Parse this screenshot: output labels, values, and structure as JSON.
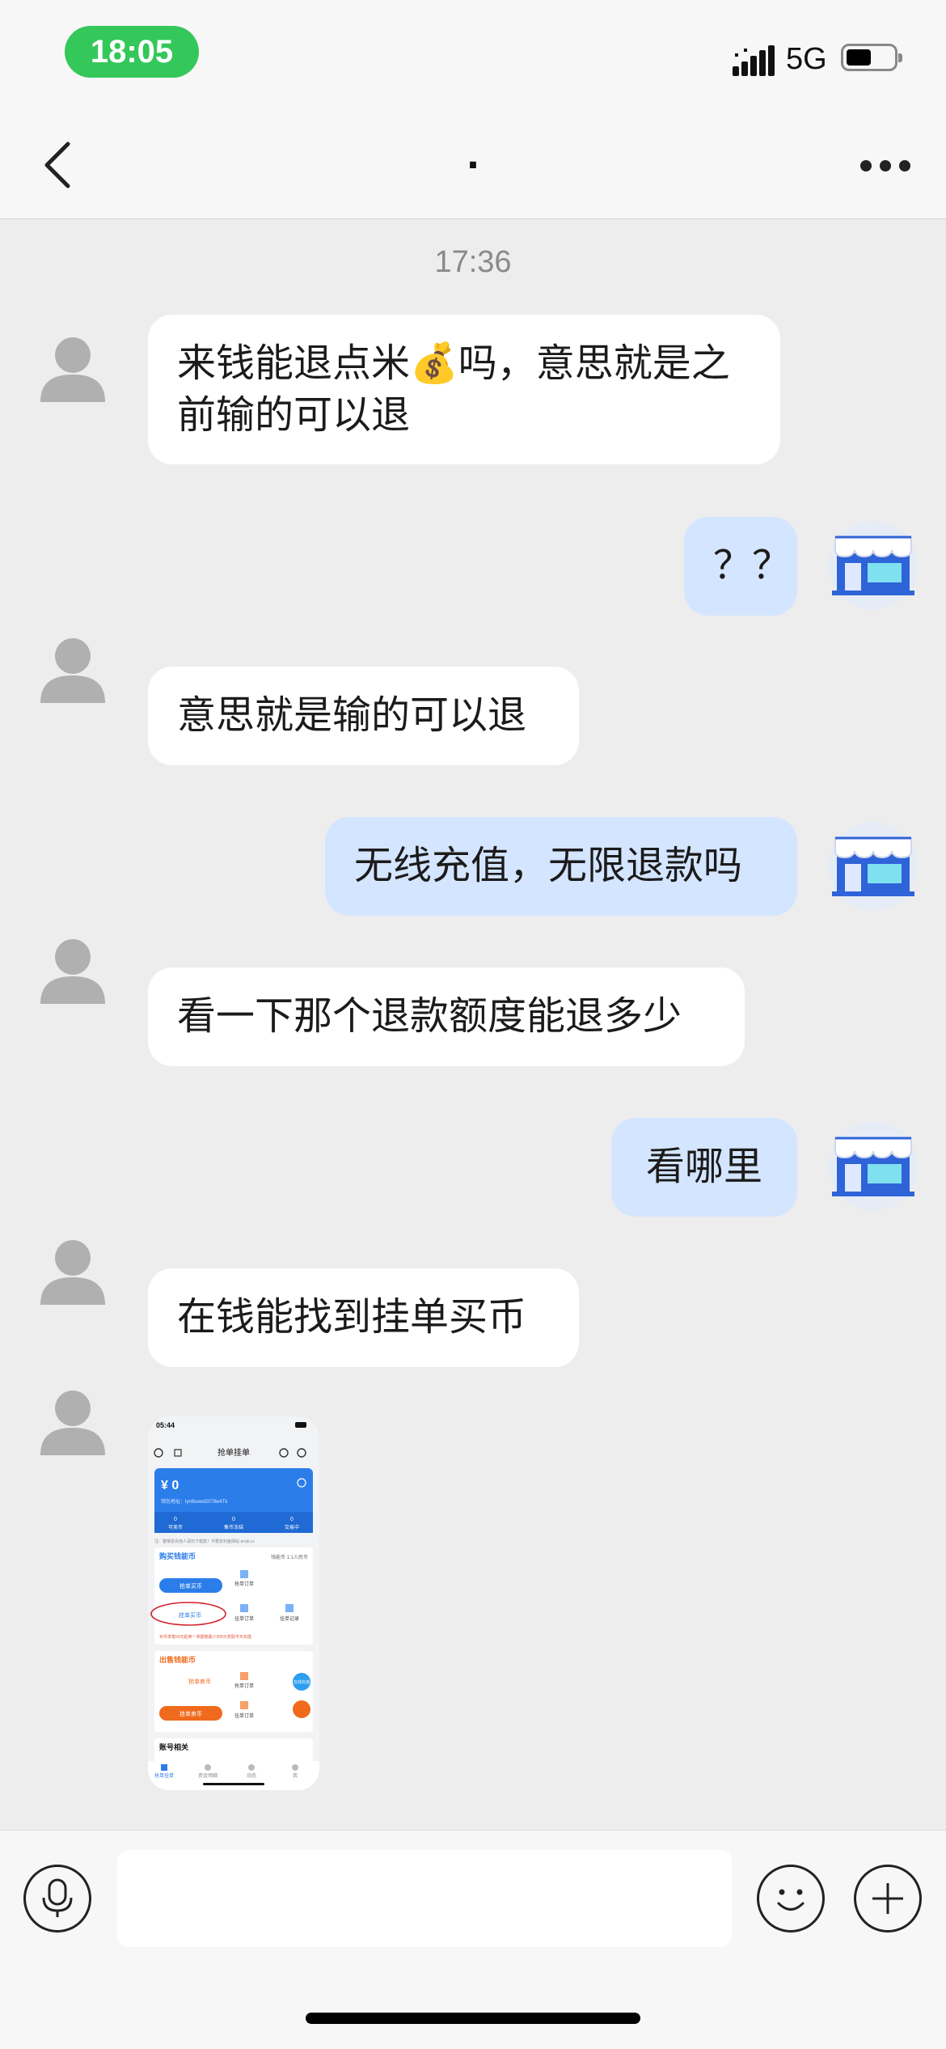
{
  "status_bar": {
    "time": "18:05",
    "network": "5G",
    "icons": [
      "signal-bars-icon",
      "battery-icon"
    ]
  },
  "nav": {
    "title": ".",
    "back_icon": "chevron-left-icon",
    "more_icon": "ellipsis-icon"
  },
  "chat": {
    "timestamp": "17:36",
    "messages": [
      {
        "side": "in",
        "text": "来钱能退点米💰吗，意思就是之前输的可以退"
      },
      {
        "side": "out",
        "text": "？？"
      },
      {
        "side": "in",
        "text": "意思就是输的可以退"
      },
      {
        "side": "out",
        "text": "无线充值，无限退款吗"
      },
      {
        "side": "in",
        "text": "看一下那个退款额度能退多少"
      },
      {
        "side": "out",
        "text": "看哪里"
      },
      {
        "side": "in",
        "text": "在钱能找到挂单买币"
      },
      {
        "side": "in",
        "type": "image"
      }
    ]
  },
  "thumbnail": {
    "time": "05:44",
    "header_title": "抢单挂单",
    "balance": "¥ 0",
    "address": "钱包地址：lyn9sxwd2079w4Tk",
    "stats": [
      {
        "value": "0",
        "label": "可卖币"
      },
      {
        "value": "0",
        "label": "售币冻结"
      },
      {
        "value": "0",
        "label": "交易中"
      }
    ],
    "notice": "注：警惕冒充他人请勿下载案！不要去钓鱼网站 anqb.cc",
    "buy_section": {
      "title": "购买钱能币",
      "rate": "钱能币 1:1人民币",
      "btn_grab": "抢单买币",
      "btn_hang": "挂单买币",
      "link_grab_orders": "抢单订单",
      "link_hang_orders": "挂单订单",
      "link_hang_records": "挂单记录"
    },
    "sell_section": {
      "title": "出售钱能币",
      "btn_grab": "抢单卖币",
      "btn_hang": "挂单卖币",
      "link_grab_orders": "抢单订单",
      "link_hang_orders": "挂单订单",
      "side_badge": "在线充值",
      "warning": "买币单笔50元起卖一单额度最少200元奖励今天充值"
    },
    "account_section": {
      "title": "账号相关"
    },
    "tabs": [
      "抢单挂单",
      "资金明细",
      "动态",
      "我"
    ]
  },
  "input_bar": {
    "placeholder": "",
    "icons": [
      "microphone-icon",
      "smiley-icon",
      "plus-icon"
    ]
  },
  "colors": {
    "outgoing_bubble": "#d4e5ff",
    "incoming_bubble": "#ffffff",
    "time_pill": "#34c759",
    "background": "#ededed"
  }
}
